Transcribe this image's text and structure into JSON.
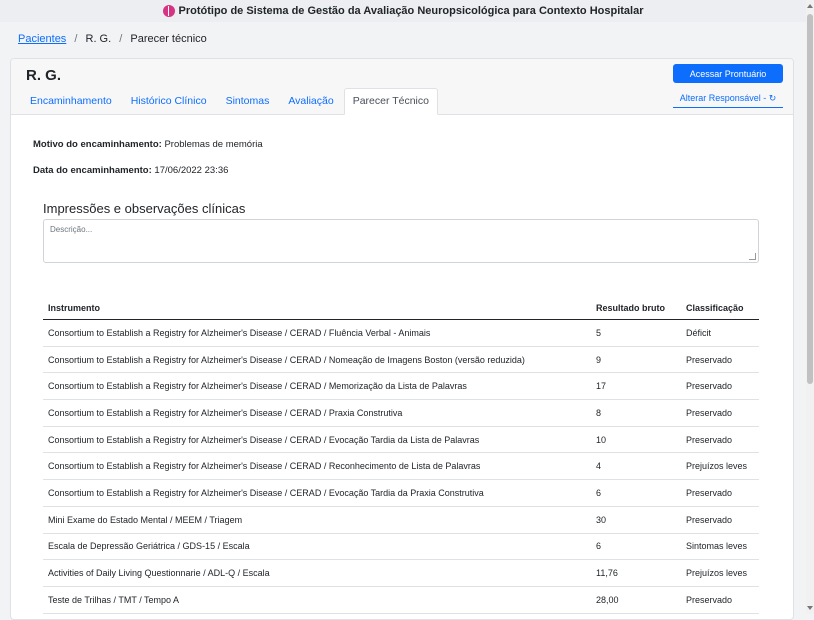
{
  "app": {
    "title": "Protótipo de Sistema de Gestão da Avaliação Neuropsicológica para Contexto Hospitalar",
    "brand_color": "#0d6efd"
  },
  "breadcrumb": {
    "root": "Pacientes",
    "patient": "R. G.",
    "current": "Parecer técnico"
  },
  "patient": {
    "name": "R. G."
  },
  "actions": {
    "open_record": "Acessar Prontuário",
    "change_responsible": "Alterar Responsável - ↻"
  },
  "tabs": [
    {
      "label": "Encaminhamento",
      "active": false
    },
    {
      "label": "Histórico Clínico",
      "active": false
    },
    {
      "label": "Sintomas",
      "active": false
    },
    {
      "label": "Avaliação",
      "active": false
    },
    {
      "label": "Parecer Técnico",
      "active": true
    }
  ],
  "referral": {
    "reason_label": "Motivo do encaminhamento:",
    "reason_value": "Problemas de memória",
    "date_label": "Data do encaminhamento:",
    "date_value": "17/06/2022 23:36"
  },
  "observations": {
    "title": "Impressões e observações clínicas",
    "placeholder": "Descrição..."
  },
  "results_table": {
    "headers": [
      "Instrumento",
      "Resultado bruto",
      "Classificação"
    ],
    "rows": [
      [
        "Consortium to Establish a Registry for Alzheimer's Disease / CERAD / Fluência Verbal - Animais",
        "5",
        "Déficit"
      ],
      [
        "Consortium to Establish a Registry for Alzheimer's Disease / CERAD / Nomeação de Imagens Boston (versão reduzida)",
        "9",
        "Preservado"
      ],
      [
        "Consortium to Establish a Registry for Alzheimer's Disease / CERAD / Memorização da Lista de Palavras",
        "17",
        "Preservado"
      ],
      [
        "Consortium to Establish a Registry for Alzheimer's Disease / CERAD / Praxia Construtiva",
        "8",
        "Preservado"
      ],
      [
        "Consortium to Establish a Registry for Alzheimer's Disease / CERAD / Evocação Tardia da Lista de Palavras",
        "10",
        "Preservado"
      ],
      [
        "Consortium to Establish a Registry for Alzheimer's Disease / CERAD / Reconhecimento de Lista de Palavras",
        "4",
        "Prejuízos leves"
      ],
      [
        "Consortium to Establish a Registry for Alzheimer's Disease / CERAD / Evocação Tardia da Praxia Construtiva",
        "6",
        "Preservado"
      ],
      [
        "Mini Exame do Estado Mental / MEEM / Triagem",
        "30",
        "Preservado"
      ],
      [
        "Escala de Depressão Geriátrica / GDS-15 / Escala",
        "6",
        "Sintomas leves"
      ],
      [
        "Activities of Daily Living Questionnarie / ADL-Q / Escala",
        "11,76",
        "Prejuízos leves"
      ],
      [
        "Teste de Trilhas / TMT / Tempo A",
        "28,00",
        "Preservado"
      ]
    ]
  }
}
